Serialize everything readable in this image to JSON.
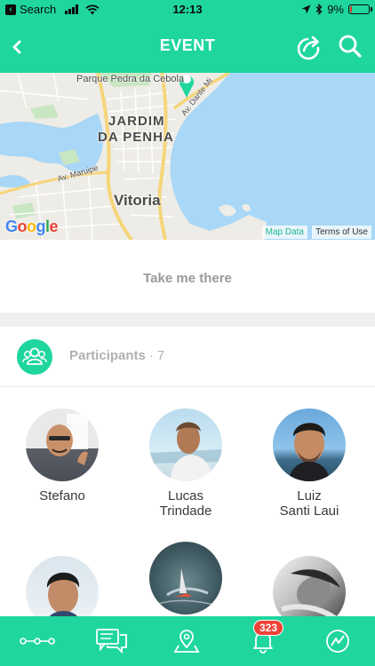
{
  "status_bar": {
    "carrier": "Search",
    "time": "12:13",
    "battery": "9%",
    "battery_level": 0.09
  },
  "header": {
    "title": "EVENT"
  },
  "map": {
    "labels": {
      "park": "Parque Pedra da Cebola",
      "district_line1": "JARDIM",
      "district_line2": "DA PENHA",
      "avenue": "Av. Maruipe",
      "beach_avenue": "Av. Dante Mi",
      "city": "Vitoria"
    },
    "google": "Google",
    "map_data": "Map Data",
    "terms": "Terms of Use"
  },
  "directions_button": "Take me there",
  "participants": {
    "label": "Participants",
    "separator": "·",
    "count": "7",
    "people": [
      {
        "line1": "Stefano",
        "line2": ""
      },
      {
        "line1": "Lucas",
        "line2": "Trindade"
      },
      {
        "line1": "Luiz",
        "line2": "Santi Laui"
      },
      {
        "line1": "",
        "line2": ""
      },
      {
        "line1": "",
        "line2": ""
      },
      {
        "line1": "",
        "line2": ""
      }
    ]
  },
  "tabbar": {
    "notification_badge": "323"
  },
  "colors": {
    "accent": "#1fd69e",
    "badge": "#ef4136",
    "muted_text": "#9a9a9a"
  }
}
